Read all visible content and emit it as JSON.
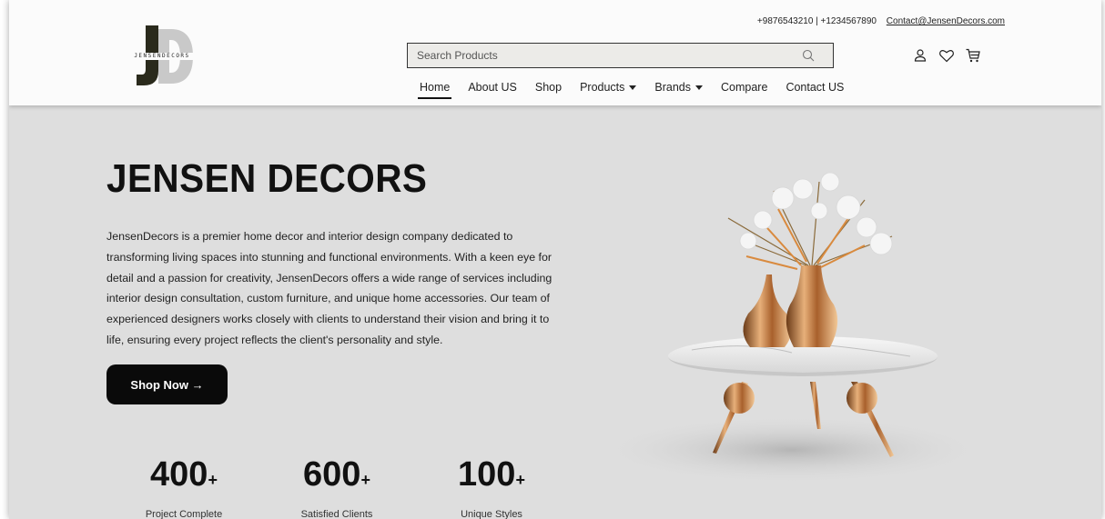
{
  "header": {
    "logo_text": "JENSENDECORS",
    "phones": "+9876543210 | +1234567890",
    "email": "Contact@JensenDecors.com",
    "search": {
      "placeholder": "Search Products"
    },
    "icons": [
      "user-icon",
      "heart-icon",
      "cart-icon"
    ]
  },
  "nav": {
    "items": [
      {
        "label": "Home",
        "active": true
      },
      {
        "label": "About US"
      },
      {
        "label": "Shop"
      },
      {
        "label": "Products",
        "dropdown": true
      },
      {
        "label": "Brands",
        "dropdown": true
      },
      {
        "label": "Compare"
      },
      {
        "label": "Contact US"
      }
    ]
  },
  "hero": {
    "title": "JENSEN DECORS",
    "description": "JensenDecors is a premier home decor and interior design company dedicated to transforming living spaces into stunning and functional environments. With a keen eye for detail and a passion for creativity, JensenDecors offers a wide range of services including interior design consultation, custom furniture, and unique home accessories. Our team of experienced designers works closely with clients to understand their vision and bring it to life, ensuring every project reflects the client's personality and style.",
    "cta_label": "Shop Now →"
  },
  "stats": [
    {
      "value": "400",
      "suffix": "+",
      "label": "Project Complete"
    },
    {
      "value": "600",
      "suffix": "+",
      "label": "Satisfied Clients"
    },
    {
      "value": "100",
      "suffix": "+",
      "label": "Unique Styles"
    }
  ],
  "colors": {
    "hero_bg": "#dedede",
    "header_bg": "#fbfbfb",
    "button_bg": "#0a0a0a",
    "accent_gold": "#c48a4e"
  }
}
